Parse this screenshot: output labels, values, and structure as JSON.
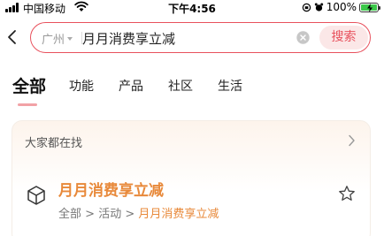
{
  "status_bar": {
    "carrier": "中国移动",
    "time": "下午4:56",
    "battery_percent": "100%"
  },
  "search": {
    "city": "广州",
    "query": "月月消费享立减",
    "button_label": "搜索"
  },
  "tabs": [
    {
      "label": "全部",
      "active": true
    },
    {
      "label": "功能",
      "active": false
    },
    {
      "label": "产品",
      "active": false
    },
    {
      "label": "社区",
      "active": false
    },
    {
      "label": "生活",
      "active": false
    }
  ],
  "section": {
    "header": "大家都在找",
    "result": {
      "title": "月月消费享立减",
      "breadcrumb": [
        "全部",
        "活动",
        "月月消费享立减"
      ],
      "separator": ">"
    }
  },
  "colors": {
    "accent_red": "#e8515d",
    "result_orange": "#e8893a",
    "battery_green": "#3cc84a"
  }
}
